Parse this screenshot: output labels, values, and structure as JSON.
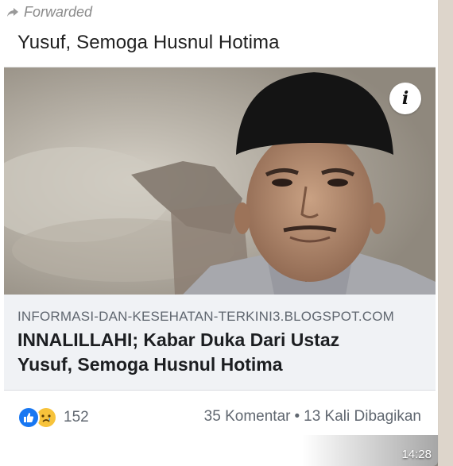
{
  "forwarded": {
    "label": "Forwarded",
    "icon": "forward-arrow-icon"
  },
  "message": {
    "title_fragment": "Yusuf, Semoga Husnul Hotima"
  },
  "link_preview": {
    "domain": "INFORMASI-DAN-KESEHATAN-TERKINI3.BLOGSPOT.COM",
    "title_line1": "INNALILLAHI; Kabar Duka Dari Ustaz",
    "title_line2": "Yusuf, Semoga Husnul Hotima",
    "info_button": "i",
    "reactions_count": "152",
    "comments": "35 Komentar",
    "separator": "•",
    "shares": "13 Kali Dibagikan"
  },
  "timestamp": "14:28",
  "colors": {
    "facebook_blue": "#1877f2",
    "sad_yellow": "#f7c33b",
    "meta_bg": "#f0f2f5"
  }
}
